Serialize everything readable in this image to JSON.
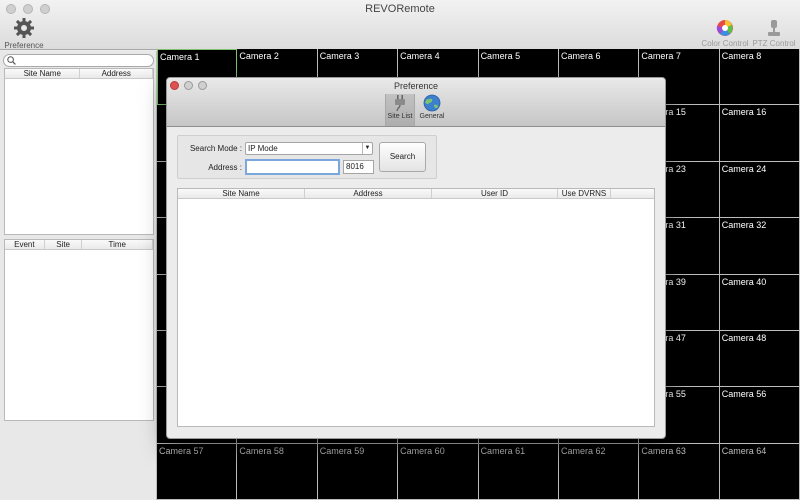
{
  "app": {
    "title": "REVORemote"
  },
  "toolbar": {
    "preference_label": "Preference",
    "color_control_label": "Color Control",
    "ptz_control_label": "PTZ Control"
  },
  "left_panel": {
    "site_table": {
      "columns": [
        "Site Name",
        "Address"
      ]
    },
    "event_table": {
      "columns": [
        "Event",
        "Site",
        "Time"
      ]
    }
  },
  "cameras": [
    "Camera 1",
    "Camera 2",
    "Camera 3",
    "Camera 4",
    "Camera 5",
    "Camera 6",
    "Camera 7",
    "Camera 8",
    "",
    "",
    "",
    "",
    "",
    "",
    "Camera 15",
    "Camera 16",
    "",
    "",
    "",
    "",
    "",
    "",
    "Camera 23",
    "Camera 24",
    "",
    "",
    "",
    "",
    "",
    "",
    "Camera 31",
    "Camera 32",
    "",
    "",
    "",
    "",
    "",
    "",
    "Camera 39",
    "Camera 40",
    "",
    "",
    "",
    "",
    "",
    "",
    "Camera 47",
    "Camera 48",
    "",
    "",
    "",
    "",
    "",
    "",
    "Camera 55",
    "Camera 56",
    "Camera 57",
    "Camera 58",
    "Camera 59",
    "Camera 60",
    "Camera 61",
    "Camera 62",
    "Camera 63",
    "Camera 64"
  ],
  "dialog": {
    "title": "Preference",
    "tabs": [
      "Site List",
      "General"
    ],
    "search_mode_label": "Search Mode :",
    "search_mode_value": "IP Mode",
    "address_label": "Address :",
    "address_value": "",
    "port_value": "8016",
    "search_button": "Search",
    "columns": [
      "Site Name",
      "Address",
      "User ID",
      "Use DVRNS"
    ]
  }
}
